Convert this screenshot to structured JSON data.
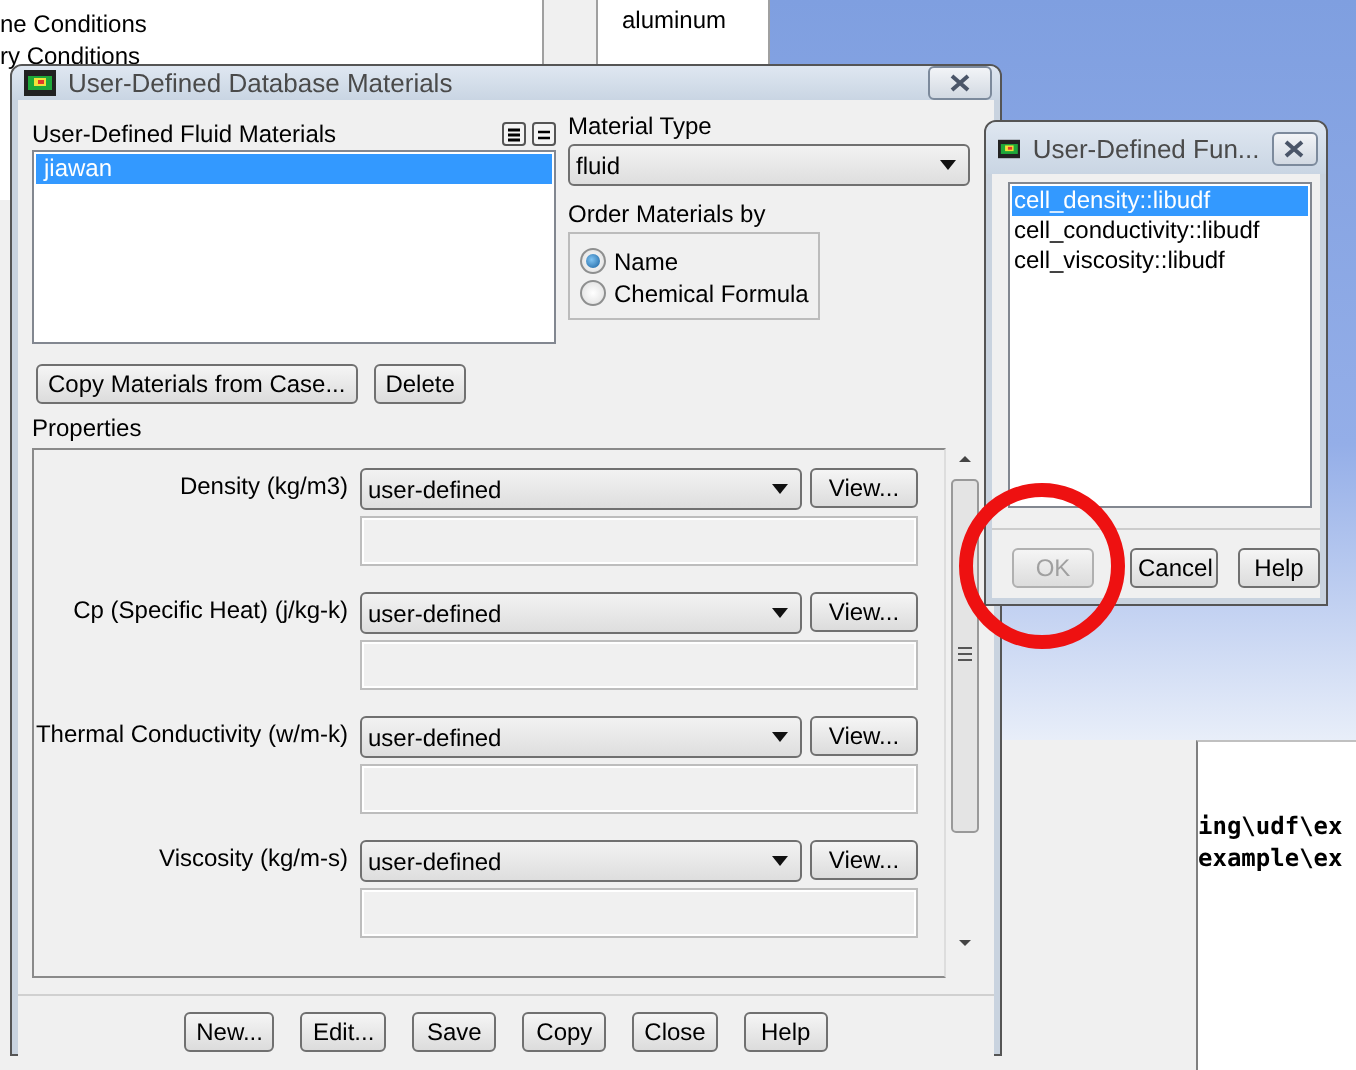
{
  "background_app": {
    "tree_items": [
      "ne Conditions",
      "ry Conditions"
    ],
    "materials_list": [
      "aluminum"
    ],
    "console_lines": [
      "ing\\udf\\ex",
      "example\\ex"
    ]
  },
  "materials_dialog": {
    "title": "User-Defined Database Materials",
    "list_label": "User-Defined Fluid Materials",
    "list_items": [
      {
        "label": "jiawan",
        "selected": true
      }
    ],
    "material_type_label": "Material Type",
    "material_type": "fluid",
    "order_label": "Order Materials by",
    "order_options": [
      {
        "label": "Name",
        "selected": true
      },
      {
        "label": "Chemical Formula",
        "selected": false
      }
    ],
    "action_buttons": [
      "Copy Materials from Case...",
      "Delete"
    ],
    "properties_label": "Properties",
    "properties": [
      {
        "label": "Density (kg/m3)",
        "method": "user-defined",
        "view_button": "View..."
      },
      {
        "label": "Cp (Specific Heat) (j/kg-k)",
        "method": "user-defined",
        "view_button": "View..."
      },
      {
        "label": "Thermal Conductivity (w/m-k)",
        "method": "user-defined",
        "view_button": "View..."
      },
      {
        "label": "Viscosity (kg/m-s)",
        "method": "user-defined",
        "view_button": "View..."
      }
    ],
    "footer_buttons": [
      "New...",
      "Edit...",
      "Save",
      "Copy",
      "Close",
      "Help"
    ]
  },
  "udf_dialog": {
    "title": "User-Defined Fun...",
    "functions": [
      {
        "label": "cell_density::libudf",
        "selected": true
      },
      {
        "label": "cell_conductivity::libudf",
        "selected": false
      },
      {
        "label": "cell_viscosity::libudf",
        "selected": false
      }
    ],
    "buttons": [
      {
        "label": "OK",
        "disabled": true
      },
      {
        "label": "Cancel",
        "disabled": false
      },
      {
        "label": "Help",
        "disabled": false
      }
    ]
  }
}
